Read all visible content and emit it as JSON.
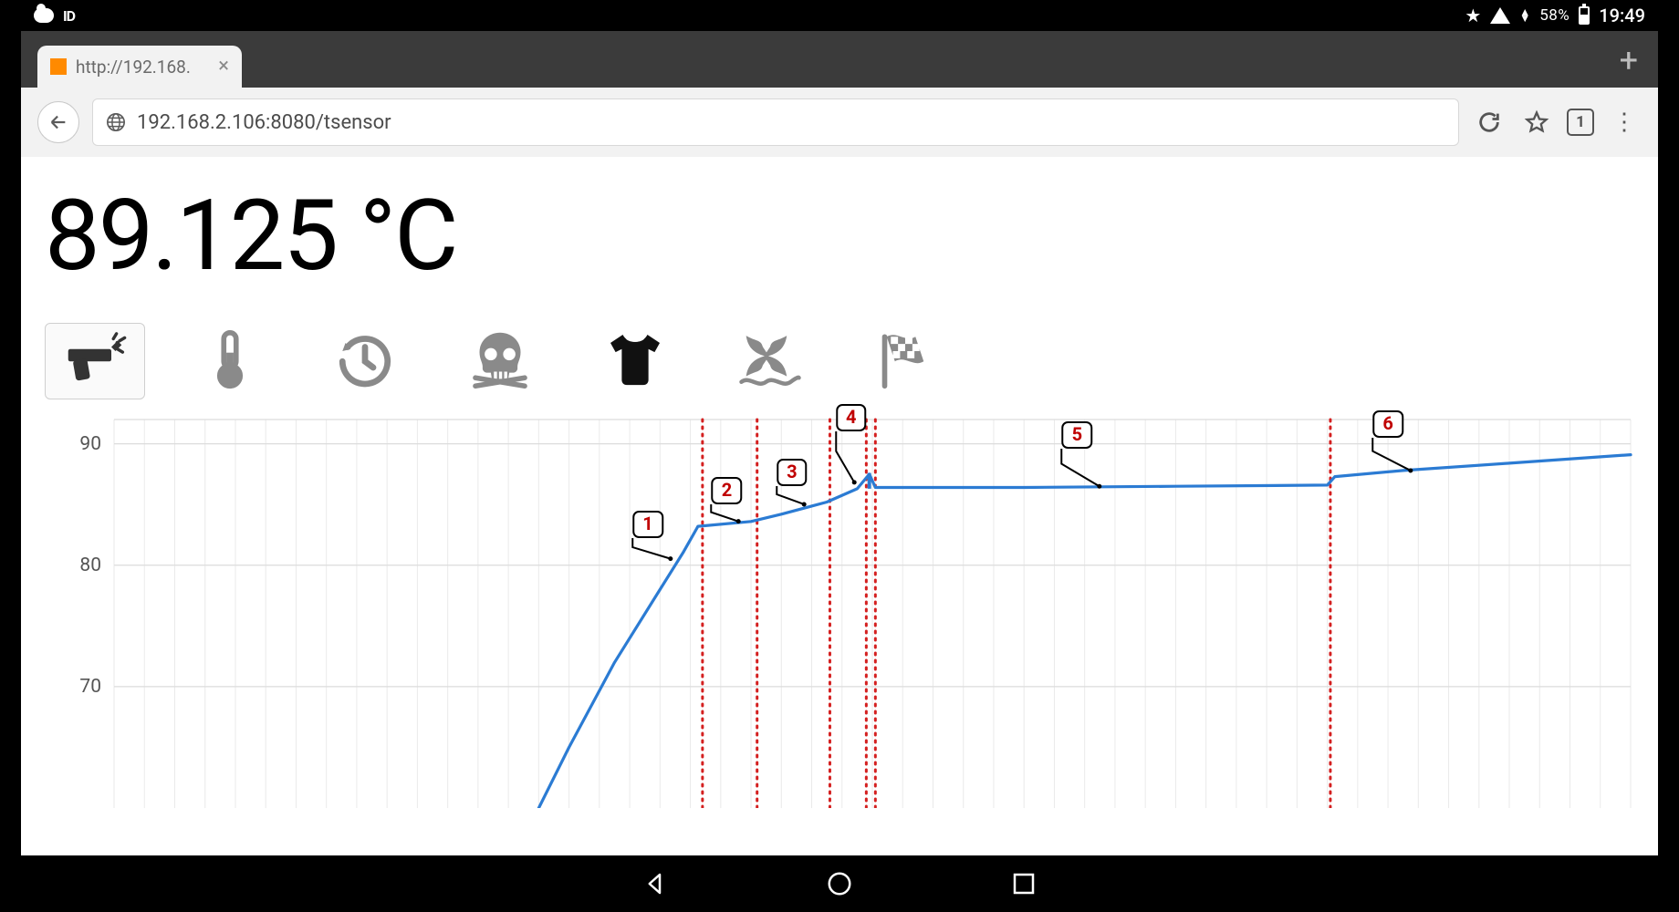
{
  "status_bar": {
    "battery_pct": "58%",
    "time": "19:49",
    "id_badge": "ID"
  },
  "browser": {
    "tab_title": "http://192.168.",
    "url": "192.168.2.106:8080/tsensor",
    "open_tabs_count": "1"
  },
  "page": {
    "temperature_display": "89.125 °C",
    "marker_icons": [
      {
        "name": "pistol-icon",
        "selected": true,
        "dark": false
      },
      {
        "name": "thermometer-icon",
        "selected": false,
        "dark": false
      },
      {
        "name": "timer-icon",
        "selected": false,
        "dark": false
      },
      {
        "name": "skull-icon",
        "selected": false,
        "dark": false
      },
      {
        "name": "tshirt-icon",
        "selected": false,
        "dark": true
      },
      {
        "name": "whale-tail-icon",
        "selected": false,
        "dark": false
      },
      {
        "name": "finish-flag-icon",
        "selected": false,
        "dark": false
      }
    ]
  },
  "chart_data": {
    "type": "line",
    "ylabel": "",
    "xlabel": "",
    "ylim": [
      60,
      92
    ],
    "xlim": [
      0,
      100
    ],
    "y_ticks": [
      70,
      80,
      90
    ],
    "series": [
      {
        "name": "temperature",
        "color": "#2b7bd3",
        "points": [
          {
            "x": 28,
            "y": 60
          },
          {
            "x": 30,
            "y": 65
          },
          {
            "x": 33,
            "y": 72
          },
          {
            "x": 36,
            "y": 78
          },
          {
            "x": 37.5,
            "y": 81
          },
          {
            "x": 38.5,
            "y": 83.2
          },
          {
            "x": 42,
            "y": 83.6
          },
          {
            "x": 44,
            "y": 84.2
          },
          {
            "x": 47,
            "y": 85.2
          },
          {
            "x": 49,
            "y": 86.3
          },
          {
            "x": 49.8,
            "y": 87.5
          },
          {
            "x": 50.2,
            "y": 86.4
          },
          {
            "x": 60,
            "y": 86.4
          },
          {
            "x": 70,
            "y": 86.5
          },
          {
            "x": 80,
            "y": 86.6
          },
          {
            "x": 80.5,
            "y": 87.3
          },
          {
            "x": 85,
            "y": 87.8
          },
          {
            "x": 92,
            "y": 88.4
          },
          {
            "x": 100,
            "y": 89.1
          }
        ]
      }
    ],
    "vlines_x": [
      38.8,
      42.4,
      47.2,
      49.6,
      50.2,
      80.2
    ],
    "annotations": [
      {
        "label": "1",
        "bubble_x": 35.2,
        "bubble_y": 82.2,
        "tip_x": 37.7,
        "tip_y": 80.5
      },
      {
        "label": "2",
        "bubble_x": 40.4,
        "bubble_y": 85.0,
        "tip_x": 42.2,
        "tip_y": 83.6
      },
      {
        "label": "3",
        "bubble_x": 44.7,
        "bubble_y": 86.5,
        "tip_x": 46.5,
        "tip_y": 85.0
      },
      {
        "label": "4",
        "bubble_x": 48.6,
        "bubble_y": 91.0,
        "tip_x": 49.8,
        "tip_y": 86.8
      },
      {
        "label": "5",
        "bubble_x": 63.5,
        "bubble_y": 89.6,
        "tip_x": 66.0,
        "tip_y": 86.5
      },
      {
        "label": "6",
        "bubble_x": 84.0,
        "bubble_y": 90.5,
        "tip_x": 86.5,
        "tip_y": 87.8
      }
    ]
  }
}
